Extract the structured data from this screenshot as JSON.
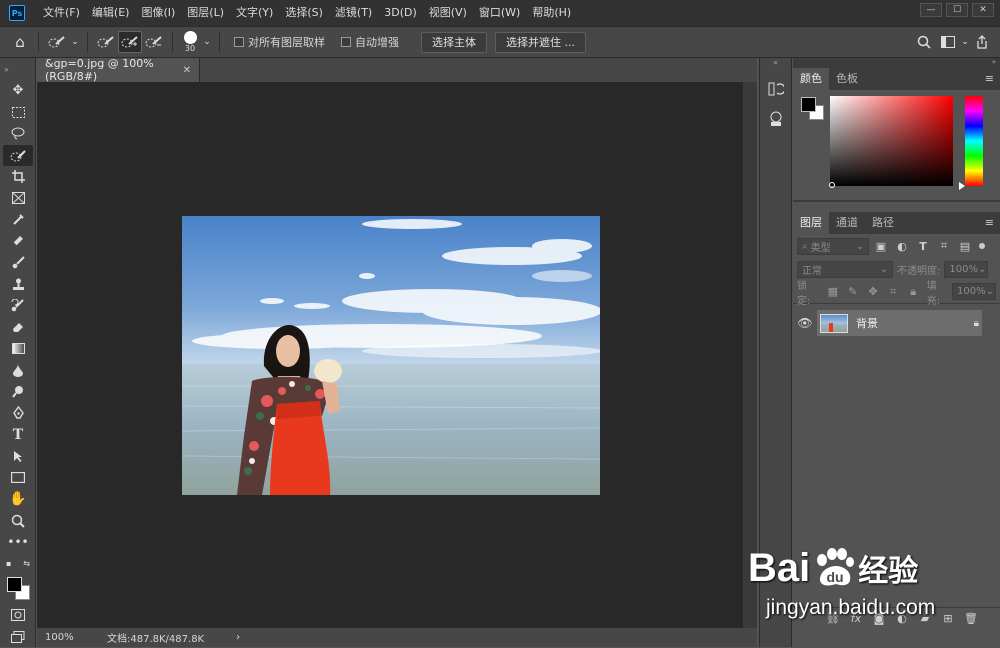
{
  "app": {
    "logo": "Ps"
  },
  "menu": [
    "文件(F)",
    "编辑(E)",
    "图像(I)",
    "图层(L)",
    "文字(Y)",
    "选择(S)",
    "滤镜(T)",
    "3D(D)",
    "视图(V)",
    "窗口(W)",
    "帮助(H)"
  ],
  "options": {
    "brush_size": "30",
    "sample_all_layers": "对所有图层取样",
    "auto_enhance": "自动增强",
    "select_subject": "选择主体",
    "select_and_mask": "选择并遮住 ..."
  },
  "document": {
    "tab_title": "&gp=0.jpg @ 100%(RGB/8#)",
    "zoom": "100%",
    "doc_info": "文档:487.8K/487.8K"
  },
  "color_panel": {
    "tabs": [
      "颜色",
      "色板"
    ],
    "hue_color": "#ff0000",
    "foreground": "#000000",
    "background": "#ffffff"
  },
  "layers_panel": {
    "tabs": [
      "图层",
      "通道",
      "路径"
    ],
    "filter_kind": "类型",
    "blend_mode": "正常",
    "opacity_label": "不透明度:",
    "opacity_value": "100%",
    "lock_label": "锁定:",
    "fill_label": "填充:",
    "fill_value": "100%",
    "layers": [
      {
        "name": "背景",
        "visible": true,
        "locked": true
      }
    ]
  },
  "watermark": {
    "brand": "Bai",
    "brand2": "经验",
    "url": "jingyan.baidu.com"
  }
}
